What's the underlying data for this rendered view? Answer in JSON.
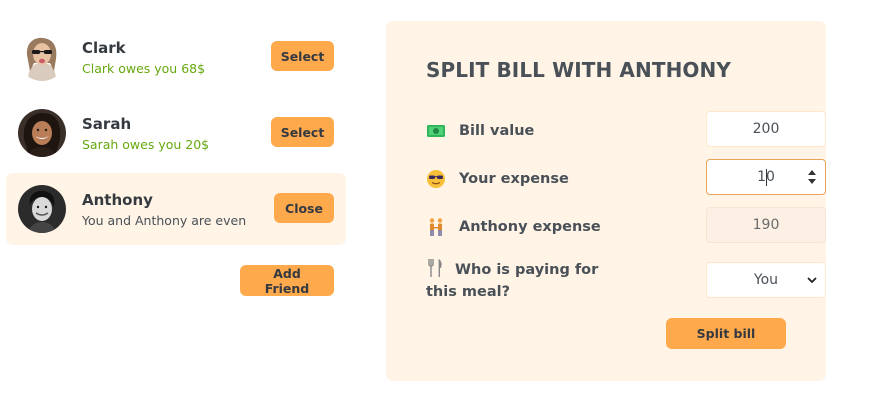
{
  "friends": [
    {
      "name": "Clark",
      "status": "Clark owes you 68$",
      "button": "Select",
      "active": false
    },
    {
      "name": "Sarah",
      "status": "Sarah owes you 20$",
      "button": "Select",
      "active": false
    },
    {
      "name": "Anthony",
      "status": "You and Anthony are even",
      "button": "Close",
      "active": true
    }
  ],
  "add_friend_label": "Add Friend",
  "form": {
    "title": "SPLIT BILL WITH ANTHONY",
    "bill_label": "Bill value",
    "bill_value": "200",
    "your_expense_label": "Your expense",
    "your_expense_value": "10",
    "friend_expense_label": "Anthony expense",
    "friend_expense_value": "190",
    "payer_label": "Who is paying for this meal?",
    "payer_value": "You",
    "submit_label": "Split bill"
  },
  "colors": {
    "accent": "#ffa94d",
    "panel": "#fff4e6",
    "green": "#66a80f"
  }
}
